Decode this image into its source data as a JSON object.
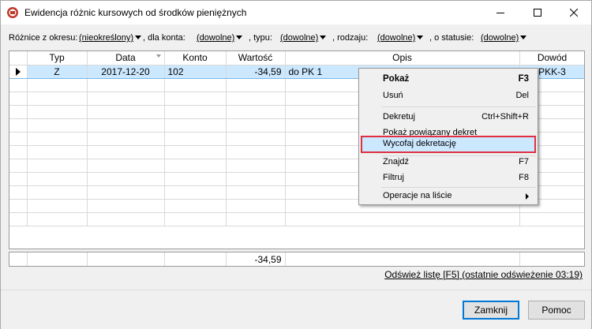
{
  "window": {
    "title": "Ewidencja różnic kursowych od środków pieniężnych"
  },
  "filters": {
    "okres_label": "Różnice z okresu:",
    "okres_value": "(nieokreślony)",
    "konto_label": ", dla konta:",
    "konto_value": "(dowolne)",
    "typ_label": ", typu:",
    "typ_value": "(dowolne)",
    "rodzaj_label": ", rodzaju:",
    "rodzaj_value": "(dowolne)",
    "status_label": ", o statusie:",
    "status_value": "(dowolne)"
  },
  "table": {
    "columns": [
      "Typ",
      "Data",
      "Konto",
      "Wartość",
      "Opis",
      "Dowód"
    ],
    "rows": [
      {
        "typ": "Z",
        "data": "2017-12-20",
        "konto": "102",
        "wartosc": "-34,59",
        "opis": "do PK 1",
        "dowod": "PKK-3"
      }
    ],
    "footer_total": "-34,59"
  },
  "refresh_text": "Odśwież listę [F5] (ostatnie odświeżenie 03:19)",
  "buttons": {
    "close": "Zamknij",
    "help": "Pomoc"
  },
  "context_menu": {
    "items": [
      {
        "label": "Pokaż",
        "shortcut": "F3"
      },
      {
        "label": "Usuń",
        "shortcut": "Del"
      },
      {
        "label": "Dekretuj",
        "shortcut": "Ctrl+Shift+R"
      },
      {
        "label": "Pokaż powiązany dekret",
        "shortcut": ""
      },
      {
        "label": "Wycofaj dekretację",
        "shortcut": ""
      },
      {
        "label": "Znajdź",
        "shortcut": "F7"
      },
      {
        "label": "Filtruj",
        "shortcut": "F8"
      },
      {
        "label": "Operacje na liście",
        "shortcut": ""
      }
    ],
    "highlighted_item": "Wycofaj dekretację"
  },
  "colors": {
    "selection": "#cce8ff",
    "highlight_border": "#e03040",
    "default_button_border": "#0078d7"
  }
}
